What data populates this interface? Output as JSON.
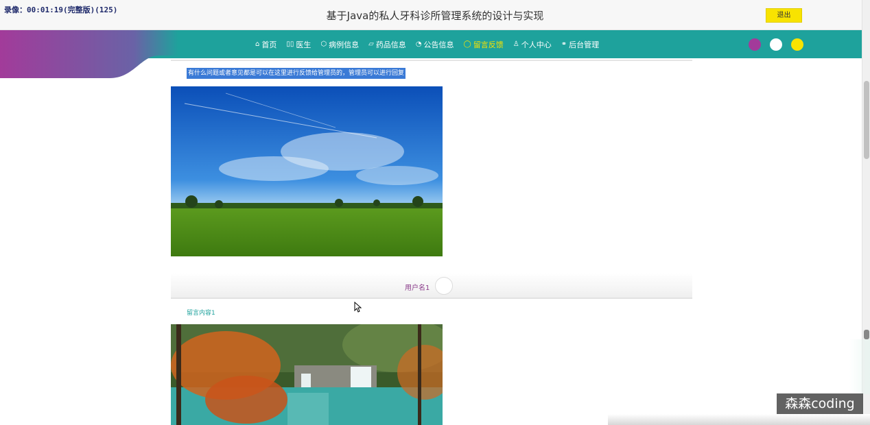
{
  "recording_label": "录像：00:01:19(完整版)(125)",
  "site_title": "基于Java的私人牙科诊所管理系统的设计与实现",
  "logout_label": "退出",
  "nav": {
    "items": [
      {
        "label": "首页",
        "icon": "home-icon",
        "glyph": "⌂"
      },
      {
        "label": "医生",
        "icon": "doctor-icon",
        "glyph": "▯▯"
      },
      {
        "label": "病例信息",
        "icon": "cube-icon",
        "glyph": "⬡"
      },
      {
        "label": "药品信息",
        "icon": "bookmark-icon",
        "glyph": "▱"
      },
      {
        "label": "公告信息",
        "icon": "dashboard-icon",
        "glyph": "◔"
      },
      {
        "label": "留言反馈",
        "icon": "chat-icon",
        "glyph": "◯"
      },
      {
        "label": "个人中心",
        "icon": "user-icon",
        "glyph": "♙"
      },
      {
        "label": "后台管理",
        "icon": "link-icon",
        "glyph": "⚭"
      }
    ],
    "active_index": 5
  },
  "theme_colors": [
    "#a23b9a",
    "#ffffff",
    "#f8e300"
  ],
  "nav_color": "#1ea29c",
  "feedback": {
    "description": "有什么问题或者意见都是可以在这里进行反馈给管理员的，管理员可以进行回复",
    "username": "用户名1",
    "message": "留言内容1"
  },
  "watermark": "森森coding"
}
